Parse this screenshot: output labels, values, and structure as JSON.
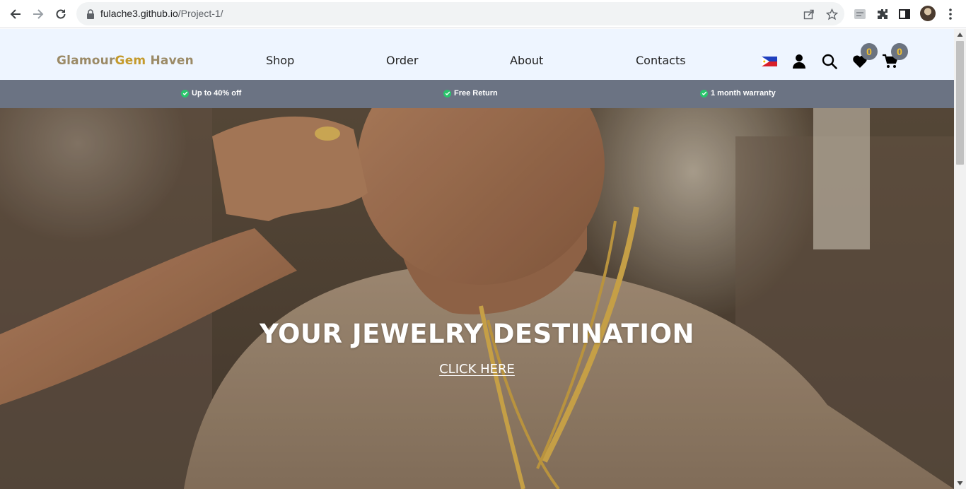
{
  "browser": {
    "url_host": "fulache3.github.io",
    "url_path": "/Project-1/",
    "icons": [
      "back-icon",
      "forward-icon",
      "reload-icon",
      "lock-icon",
      "share-icon",
      "bookmark-star-icon",
      "extension-icon",
      "puzzle-icon",
      "side-panel-icon",
      "profile-avatar",
      "menu-kebab-icon"
    ]
  },
  "header": {
    "brand_part1": "Glamour",
    "brand_part2": "Gem",
    "brand_part3": " Haven",
    "nav": {
      "shop": "Shop",
      "order": "Order",
      "about": "About",
      "contacts": "Contacts"
    },
    "wishlist_count": "0",
    "cart_count": "0",
    "icons": [
      "philippines-flag-icon",
      "user-icon",
      "search-icon",
      "heart-icon",
      "cart-icon"
    ]
  },
  "promo": {
    "item1": "Up to 40% off",
    "item2": "Free Return",
    "item3": "1 month warranty"
  },
  "hero": {
    "title": "YOUR JEWELRY DESTINATION",
    "cta": "CLICK HERE"
  },
  "colors": {
    "header_bg": "#eef5ff",
    "promo_bg": "#6b7383",
    "brand_gold": "#c49a2c",
    "badge_bg": "#6b7380",
    "badge_text": "#f2c12e",
    "check_green": "#29c56b"
  }
}
